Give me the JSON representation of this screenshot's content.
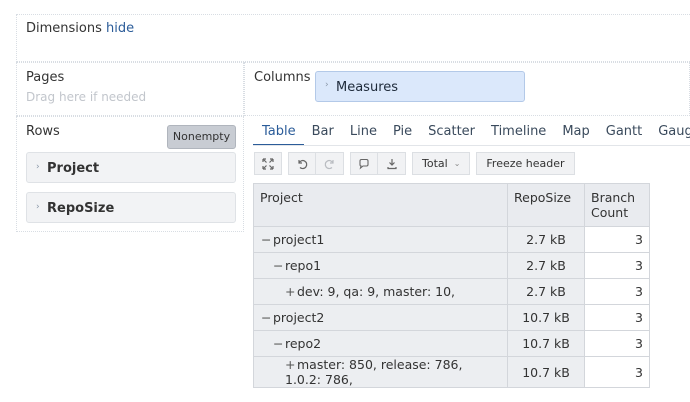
{
  "dimensions": {
    "title": "Dimensions",
    "hide_label": "hide"
  },
  "pages": {
    "title": "Pages",
    "hint": "Drag here if needed"
  },
  "columns": {
    "title": "Columns",
    "chips": [
      {
        "label": "Measures"
      }
    ]
  },
  "rows": {
    "title": "Rows",
    "nonempty_label": "Nonempty",
    "chips": [
      {
        "label": "Project"
      },
      {
        "label": "RepoSize"
      }
    ]
  },
  "tabs": [
    {
      "label": "Table",
      "active": true
    },
    {
      "label": "Bar"
    },
    {
      "label": "Line"
    },
    {
      "label": "Pie"
    },
    {
      "label": "Scatter"
    },
    {
      "label": "Timeline"
    },
    {
      "label": "Map"
    },
    {
      "label": "Gantt"
    },
    {
      "label": "Gauge"
    }
  ],
  "toolbar": {
    "total_label": "Total",
    "freeze_label": "Freeze header",
    "icons": [
      "expand-icon",
      "undo-icon",
      "redo-icon",
      "comment-icon",
      "export-icon"
    ]
  },
  "table": {
    "headers": {
      "project": "Project",
      "reposize": "RepoSize",
      "branch_count": "Branch Count"
    },
    "rows": [
      {
        "sign": "−",
        "level": 0,
        "label": "project1",
        "size": "2.7 kB",
        "count": "3"
      },
      {
        "sign": "−",
        "level": 1,
        "label": "repo1",
        "size": "2.7 kB",
        "count": "3"
      },
      {
        "sign": "+",
        "level": 2,
        "label": "dev: 9, qa: 9, master: 10,",
        "size": "2.7 kB",
        "count": "3"
      },
      {
        "sign": "−",
        "level": 0,
        "label": "project2",
        "size": "10.7 kB",
        "count": "3"
      },
      {
        "sign": "−",
        "level": 1,
        "label": "repo2",
        "size": "10.7 kB",
        "count": "3"
      },
      {
        "sign": "+",
        "level": 2,
        "label": "master: 850, release: 786, 1.0.2: 786,",
        "size": "10.7 kB",
        "count": "3"
      }
    ]
  }
}
